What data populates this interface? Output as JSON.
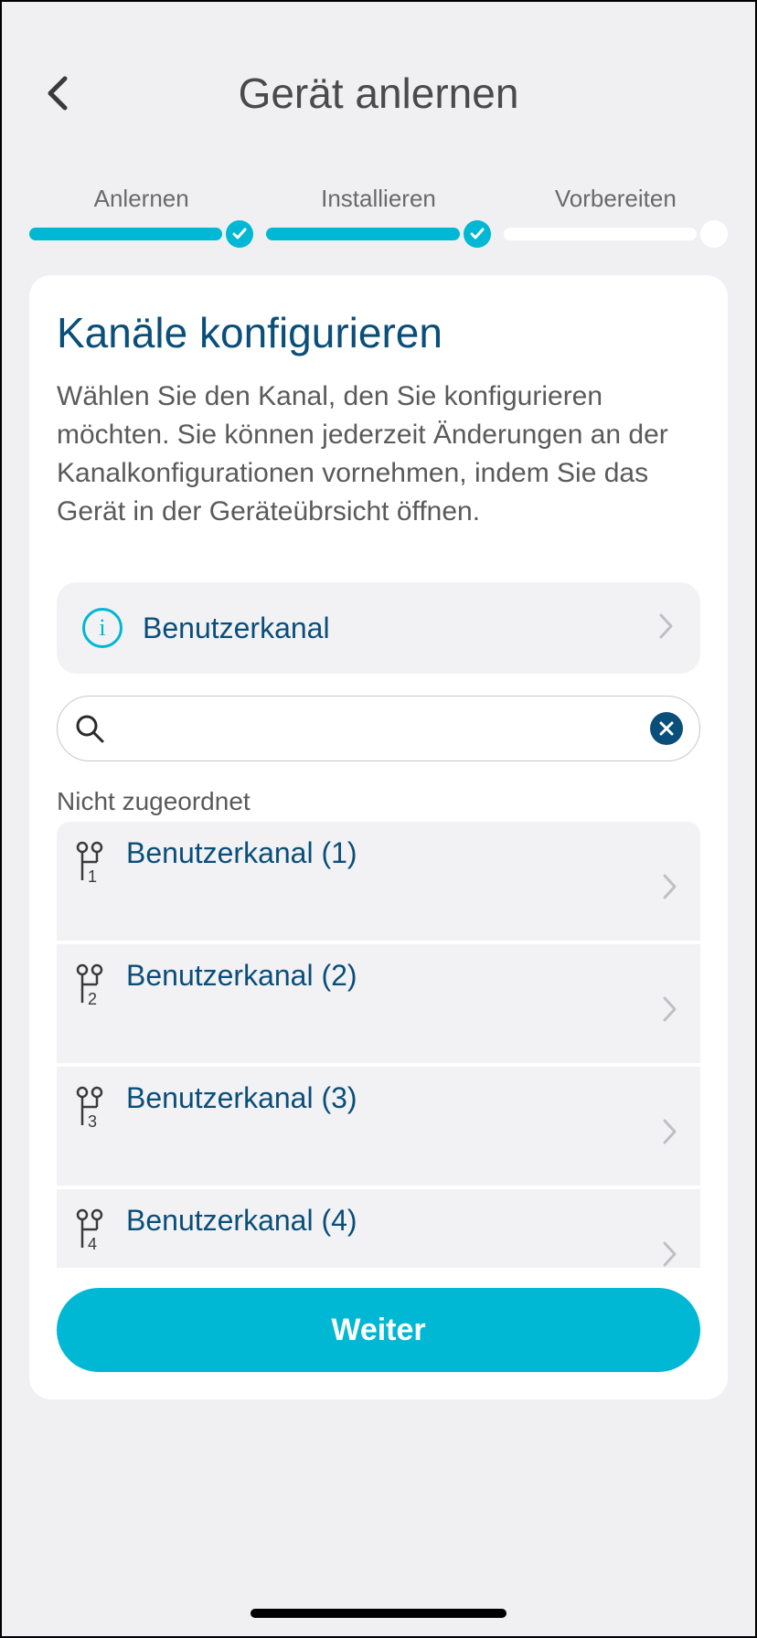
{
  "header": {
    "title": "Gerät anlernen"
  },
  "stepper": {
    "steps": [
      {
        "label": "Anlernen",
        "done": true
      },
      {
        "label": "Installieren",
        "done": true
      },
      {
        "label": "Vorbereiten",
        "done": false
      }
    ]
  },
  "card": {
    "title": "Kanäle konfigurieren",
    "description": "Wählen Sie den Kanal, den Sie konfigurieren möchten. Sie können jederzeit Änderungen an der Kanalkonfigurationen vornehmen, indem Sie das Gerät in der Geräteübrsicht öffnen.",
    "info_label": "Benutzerkanal",
    "search_value": "",
    "section_label": "Nicht zugeordnet",
    "channels": [
      {
        "label": "Benutzerkanal (1)",
        "num": "1"
      },
      {
        "label": "Benutzerkanal (2)",
        "num": "2"
      },
      {
        "label": "Benutzerkanal (3)",
        "num": "3"
      },
      {
        "label": "Benutzerkanal (4)",
        "num": "4"
      }
    ],
    "continue_label": "Weiter"
  },
  "colors": {
    "accent": "#00b7d4",
    "primary_text": "#0a4e7a"
  }
}
